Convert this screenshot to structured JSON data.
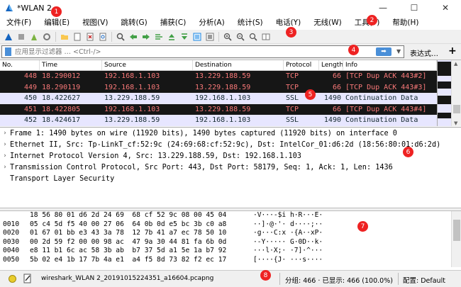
{
  "window": {
    "title": "*WLAN 2",
    "minimize": "—",
    "maximize": "☐",
    "close": "✕"
  },
  "menu": [
    "文件(F)",
    "编辑(E)",
    "视图(V)",
    "跳转(G)",
    "捕获(C)",
    "分析(A)",
    "统计(S)",
    "电话(Y)",
    "无线(W)",
    "工具(T)",
    "帮助(H)"
  ],
  "filter": {
    "placeholder": "应用显示过滤器 … <Ctrl-/>",
    "apply_glyph": "➡",
    "dropdown_glyph": "▼",
    "expression_label": "表达式…",
    "add_glyph": "+"
  },
  "packet_list": {
    "columns": [
      "No.",
      "Time",
      "Source",
      "Destination",
      "Protocol",
      "Length",
      "Info"
    ],
    "rows": [
      {
        "no": "448",
        "time": "18.290012",
        "src": "192.168.1.103",
        "dst": "13.229.188.59",
        "proto": "TCP",
        "len": "66",
        "info": "[TCP Dup ACK 443#2]",
        "style": "dup"
      },
      {
        "no": "449",
        "time": "18.290119",
        "src": "192.168.1.103",
        "dst": "13.229.188.59",
        "proto": "TCP",
        "len": "66",
        "info": "[TCP Dup ACK 443#3]",
        "style": "dup"
      },
      {
        "no": "450",
        "time": "18.422627",
        "src": "13.229.188.59",
        "dst": "192.168.1.103",
        "proto": "SSL",
        "len": "1490",
        "info": "Continuation Data",
        "style": "ssl"
      },
      {
        "no": "451",
        "time": "18.422805",
        "src": "192.168.1.103",
        "dst": "13.229.188.59",
        "proto": "TCP",
        "len": "66",
        "info": "[TCP Dup ACK 443#4]",
        "style": "dup"
      },
      {
        "no": "452",
        "time": "18.424617",
        "src": "13.229.188.59",
        "dst": "192.168.1.103",
        "proto": "SSL",
        "len": "1490",
        "info": "Continuation Data",
        "style": "ssl"
      }
    ]
  },
  "details": [
    {
      "expandable": true,
      "text": "Frame 1: 1490 bytes on wire (11920 bits), 1490 bytes captured (11920 bits) on interface 0"
    },
    {
      "expandable": true,
      "text": "Ethernet II, Src: Tp-LinkT_cf:52:9c (24:69:68:cf:52:9c), Dst: IntelCor_01:d6:2d (18:56:80:01:d6:2d)"
    },
    {
      "expandable": true,
      "text": "Internet Protocol Version 4, Src: 13.229.188.59, Dst: 192.168.1.103"
    },
    {
      "expandable": true,
      "text": "Transmission Control Protocol, Src Port: 443, Dst Port: 58179, Seq: 1, Ack: 1, Len: 1436"
    },
    {
      "expandable": false,
      "text": "Transport Layer Security"
    }
  ],
  "hex": [
    {
      "offset": "",
      "bytes": "18 56 80 01 d6 2d 24 69  68 cf 52 9c 08 00 45 04",
      "ascii": "·V···-$i h·R···E·"
    },
    {
      "offset": "0010",
      "bytes": "05 c4 5d f5 40 00 27 06  64 0b 0d e5 bc 3b c0 a8",
      "ascii": "··]·@·'· d····;··"
    },
    {
      "offset": "0020",
      "bytes": "01 67 01 bb e3 43 3a 78  12 7b 41 a7 ec 78 50 10",
      "ascii": "·g···C:x ·{A··xP·"
    },
    {
      "offset": "0030",
      "bytes": "00 2d 59 f2 00 00 98 ac  47 9a 30 44 81 fa 6b 0d",
      "ascii": "·-Y····· G·0D··k·"
    },
    {
      "offset": "0040",
      "bytes": "e8 11 b1 6c ac 58 3b ab  b7 37 5d a1 5e 1a b7 92",
      "ascii": "···l·X;· ·7]·^···"
    },
    {
      "offset": "0050",
      "bytes": "5b 02 e4 1b 17 7b 4a e1  a4 f5 8d 73 82 f2 ec 17",
      "ascii": "[····{J· ···s····"
    }
  ],
  "status": {
    "file": "wireshark_WLAN 2_20191015224351_a16604.pcapng",
    "packets": "分组: 466 · 已显示: 466 (100.0%)",
    "profile": "配置: Default"
  },
  "badges": [
    "1",
    "2",
    "3",
    "4",
    "5",
    "6",
    "7",
    "8"
  ],
  "colors": {
    "dup_bg": "#161616",
    "dup_fg": "#f87878",
    "ssl_bg": "#e7e6ff",
    "ssl_fg": "#12272e",
    "badge": "#e22222",
    "accent": "#4a8fd8"
  }
}
